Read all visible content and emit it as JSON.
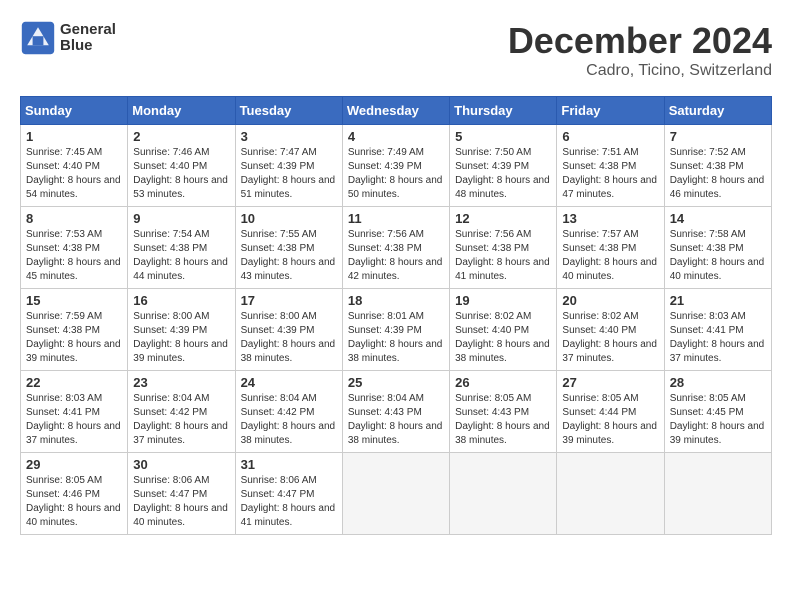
{
  "logo": {
    "line1": "General",
    "line2": "Blue"
  },
  "title": "December 2024",
  "location": "Cadro, Ticino, Switzerland",
  "days_of_week": [
    "Sunday",
    "Monday",
    "Tuesday",
    "Wednesday",
    "Thursday",
    "Friday",
    "Saturday"
  ],
  "weeks": [
    [
      {
        "day": "1",
        "sunrise": "7:45 AM",
        "sunset": "4:40 PM",
        "daylight": "8 hours and 54 minutes."
      },
      {
        "day": "2",
        "sunrise": "7:46 AM",
        "sunset": "4:40 PM",
        "daylight": "8 hours and 53 minutes."
      },
      {
        "day": "3",
        "sunrise": "7:47 AM",
        "sunset": "4:39 PM",
        "daylight": "8 hours and 51 minutes."
      },
      {
        "day": "4",
        "sunrise": "7:49 AM",
        "sunset": "4:39 PM",
        "daylight": "8 hours and 50 minutes."
      },
      {
        "day": "5",
        "sunrise": "7:50 AM",
        "sunset": "4:39 PM",
        "daylight": "8 hours and 48 minutes."
      },
      {
        "day": "6",
        "sunrise": "7:51 AM",
        "sunset": "4:38 PM",
        "daylight": "8 hours and 47 minutes."
      },
      {
        "day": "7",
        "sunrise": "7:52 AM",
        "sunset": "4:38 PM",
        "daylight": "8 hours and 46 minutes."
      }
    ],
    [
      {
        "day": "8",
        "sunrise": "7:53 AM",
        "sunset": "4:38 PM",
        "daylight": "8 hours and 45 minutes."
      },
      {
        "day": "9",
        "sunrise": "7:54 AM",
        "sunset": "4:38 PM",
        "daylight": "8 hours and 44 minutes."
      },
      {
        "day": "10",
        "sunrise": "7:55 AM",
        "sunset": "4:38 PM",
        "daylight": "8 hours and 43 minutes."
      },
      {
        "day": "11",
        "sunrise": "7:56 AM",
        "sunset": "4:38 PM",
        "daylight": "8 hours and 42 minutes."
      },
      {
        "day": "12",
        "sunrise": "7:56 AM",
        "sunset": "4:38 PM",
        "daylight": "8 hours and 41 minutes."
      },
      {
        "day": "13",
        "sunrise": "7:57 AM",
        "sunset": "4:38 PM",
        "daylight": "8 hours and 40 minutes."
      },
      {
        "day": "14",
        "sunrise": "7:58 AM",
        "sunset": "4:38 PM",
        "daylight": "8 hours and 40 minutes."
      }
    ],
    [
      {
        "day": "15",
        "sunrise": "7:59 AM",
        "sunset": "4:38 PM",
        "daylight": "8 hours and 39 minutes."
      },
      {
        "day": "16",
        "sunrise": "8:00 AM",
        "sunset": "4:39 PM",
        "daylight": "8 hours and 39 minutes."
      },
      {
        "day": "17",
        "sunrise": "8:00 AM",
        "sunset": "4:39 PM",
        "daylight": "8 hours and 38 minutes."
      },
      {
        "day": "18",
        "sunrise": "8:01 AM",
        "sunset": "4:39 PM",
        "daylight": "8 hours and 38 minutes."
      },
      {
        "day": "19",
        "sunrise": "8:02 AM",
        "sunset": "4:40 PM",
        "daylight": "8 hours and 38 minutes."
      },
      {
        "day": "20",
        "sunrise": "8:02 AM",
        "sunset": "4:40 PM",
        "daylight": "8 hours and 37 minutes."
      },
      {
        "day": "21",
        "sunrise": "8:03 AM",
        "sunset": "4:41 PM",
        "daylight": "8 hours and 37 minutes."
      }
    ],
    [
      {
        "day": "22",
        "sunrise": "8:03 AM",
        "sunset": "4:41 PM",
        "daylight": "8 hours and 37 minutes."
      },
      {
        "day": "23",
        "sunrise": "8:04 AM",
        "sunset": "4:42 PM",
        "daylight": "8 hours and 37 minutes."
      },
      {
        "day": "24",
        "sunrise": "8:04 AM",
        "sunset": "4:42 PM",
        "daylight": "8 hours and 38 minutes."
      },
      {
        "day": "25",
        "sunrise": "8:04 AM",
        "sunset": "4:43 PM",
        "daylight": "8 hours and 38 minutes."
      },
      {
        "day": "26",
        "sunrise": "8:05 AM",
        "sunset": "4:43 PM",
        "daylight": "8 hours and 38 minutes."
      },
      {
        "day": "27",
        "sunrise": "8:05 AM",
        "sunset": "4:44 PM",
        "daylight": "8 hours and 39 minutes."
      },
      {
        "day": "28",
        "sunrise": "8:05 AM",
        "sunset": "4:45 PM",
        "daylight": "8 hours and 39 minutes."
      }
    ],
    [
      {
        "day": "29",
        "sunrise": "8:05 AM",
        "sunset": "4:46 PM",
        "daylight": "8 hours and 40 minutes."
      },
      {
        "day": "30",
        "sunrise": "8:06 AM",
        "sunset": "4:47 PM",
        "daylight": "8 hours and 40 minutes."
      },
      {
        "day": "31",
        "sunrise": "8:06 AM",
        "sunset": "4:47 PM",
        "daylight": "8 hours and 41 minutes."
      },
      null,
      null,
      null,
      null
    ]
  ]
}
